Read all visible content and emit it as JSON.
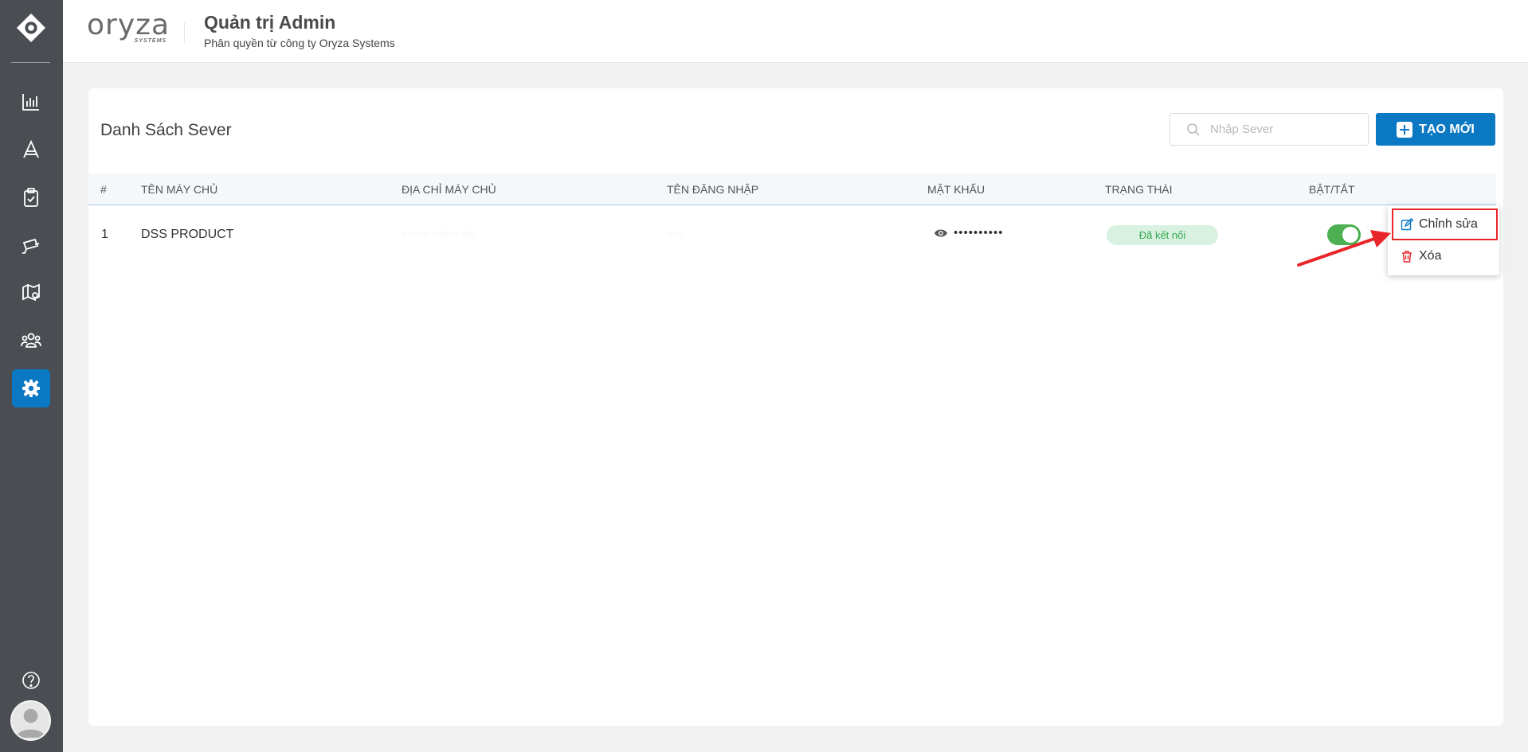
{
  "header": {
    "brand_name": "oryza",
    "brand_sub": "SYSTEMS",
    "title": "Quản trị Admin",
    "subtitle": "Phân quyền từ công ty Oryza Systems"
  },
  "sidebar": {
    "items": [
      {
        "icon": "bar-chart-icon"
      },
      {
        "icon": "text-a-icon"
      },
      {
        "icon": "clipboard-check-icon"
      },
      {
        "icon": "camera-icon"
      },
      {
        "icon": "map-pin-icon"
      },
      {
        "icon": "users-icon"
      },
      {
        "icon": "settings-gear-icon",
        "active": true
      }
    ],
    "help_icon": "help-circle-icon",
    "avatar_icon": "user-avatar-icon"
  },
  "main": {
    "title": "Danh Sách Sever",
    "search": {
      "placeholder": "Nhập Sever",
      "value": ""
    },
    "create_label": "TẠO MỚI",
    "table": {
      "columns": [
        "#",
        "TÊN MÁY CHỦ",
        "ĐỊA CHỈ MÁY CHỦ",
        "TÊN ĐĂNG NHẬP",
        "MẬT KHẨU",
        "TRẠNG THÁI",
        "BẬT/TẮT"
      ],
      "rows": [
        {
          "index": "1",
          "name": "DSS PRODUCT",
          "address": "· ·  ··· ···· · ···",
          "username": "·· ·",
          "password": "••••••••••",
          "status": "Đã kết nối",
          "enabled": true
        }
      ]
    },
    "context_menu": {
      "edit_label": "Chỉnh sửa",
      "delete_label": "Xóa"
    }
  },
  "colors": {
    "accent": "#0b78c4",
    "sidebar_bg": "#4a4d52",
    "status_bg": "#d8f1e0",
    "status_text": "#34a853",
    "toggle_on": "#4caf50",
    "annotation": "#e8262a"
  }
}
